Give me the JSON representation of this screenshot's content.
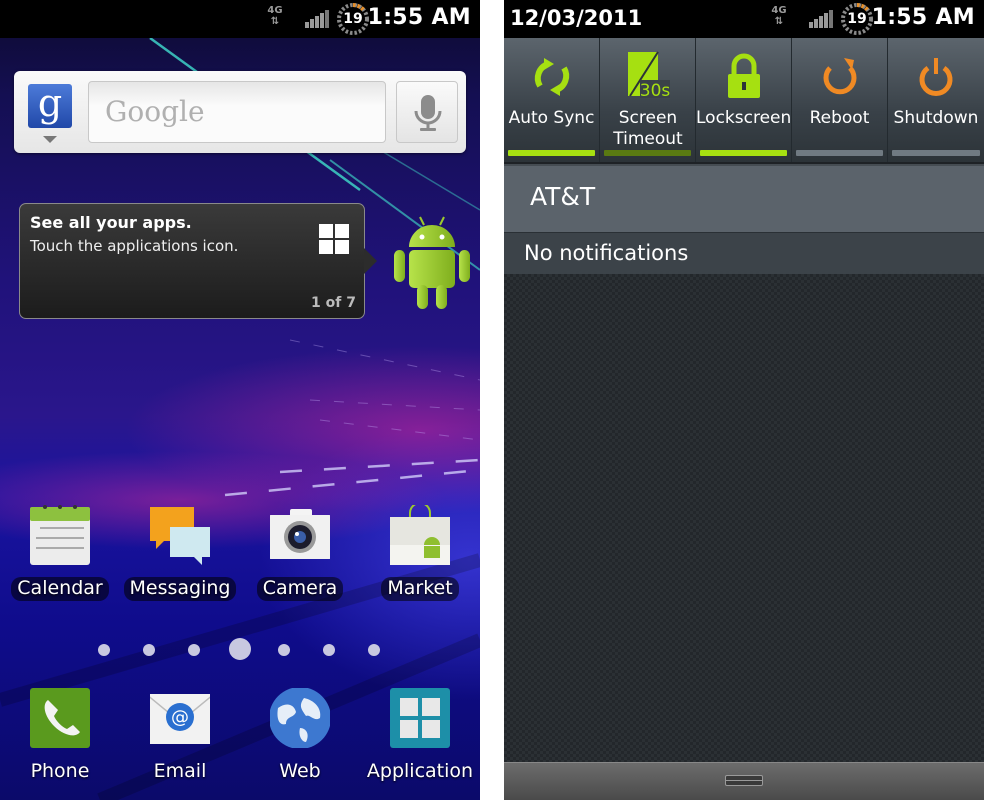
{
  "home_screen": {
    "status_bar": {
      "network_type": "4G",
      "battery_level": "19",
      "time": "1:55 AM"
    },
    "search_widget": {
      "placeholder": "Google",
      "logo_letter": "g",
      "voice_icon": "mic-icon"
    },
    "tooltip": {
      "title": "See all your apps.",
      "text": "Touch the applications icon.",
      "page_indicator": "1 of 7",
      "icon": "apps-grid-icon"
    },
    "apps_row": [
      {
        "label": "Calendar",
        "icon": "calendar-icon"
      },
      {
        "label": "Messaging",
        "icon": "messaging-icon"
      },
      {
        "label": "Camera",
        "icon": "camera-icon"
      },
      {
        "label": "Market",
        "icon": "market-icon"
      }
    ],
    "page_dots": {
      "count": 7,
      "active_index": 3
    },
    "dock": [
      {
        "label": "Phone",
        "icon": "phone-icon"
      },
      {
        "label": "Email",
        "icon": "email-icon"
      },
      {
        "label": "Web",
        "icon": "globe-icon"
      },
      {
        "label": "Application",
        "icon": "apps-grid-icon"
      }
    ],
    "colors": {
      "accent_green": "#9fd10f",
      "google_blue": "#2f5fc6"
    }
  },
  "notification_screen": {
    "status_bar": {
      "date": "12/03/2011",
      "network_type": "4G",
      "battery_level": "19",
      "time": "1:55 AM"
    },
    "quick_settings": [
      {
        "label": "Auto Sync",
        "icon": "sync-icon",
        "state": "on"
      },
      {
        "label": "Screen Timeout",
        "icon": "screen-timeout-icon",
        "icon_text": "30s",
        "state": "partial"
      },
      {
        "label": "Lockscreen",
        "icon": "lock-icon",
        "state": "on"
      },
      {
        "label": "Reboot",
        "icon": "reboot-icon",
        "state": "off"
      },
      {
        "label": "Shutdown",
        "icon": "power-icon",
        "state": "off"
      }
    ],
    "carrier": "AT&T",
    "notifications_header": "No notifications",
    "colors": {
      "toggle_on": "#a6e011",
      "toggle_partial": "#5a7a12",
      "toggle_off": "#707a82",
      "orange_icon": "#f08a24"
    }
  }
}
